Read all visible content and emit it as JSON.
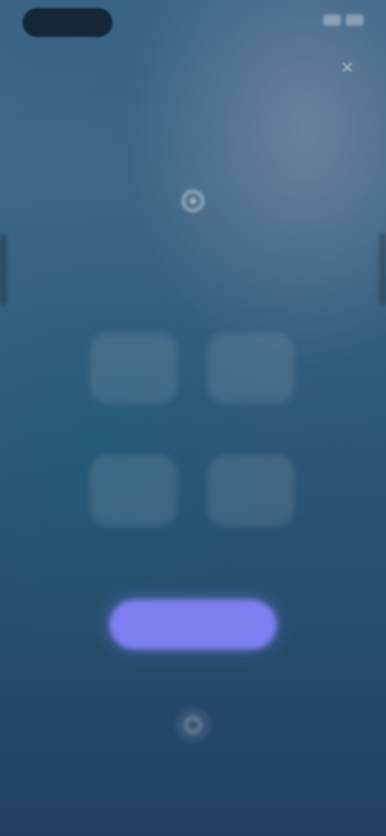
{
  "status_bar": {
    "time": ""
  },
  "dialog": {
    "title": "",
    "subtitle": ""
  },
  "cards": [
    {
      "label": ""
    },
    {
      "label": ""
    },
    {
      "label": ""
    },
    {
      "label": ""
    }
  ],
  "primary_button": {
    "label": ""
  },
  "icons": {
    "close": "close-icon",
    "header": "sparkle-icon",
    "footer": "info-icon"
  },
  "colors": {
    "accent": "#7c7ff0",
    "background_top": "#2d5a7e",
    "background_bottom": "#213f62"
  }
}
